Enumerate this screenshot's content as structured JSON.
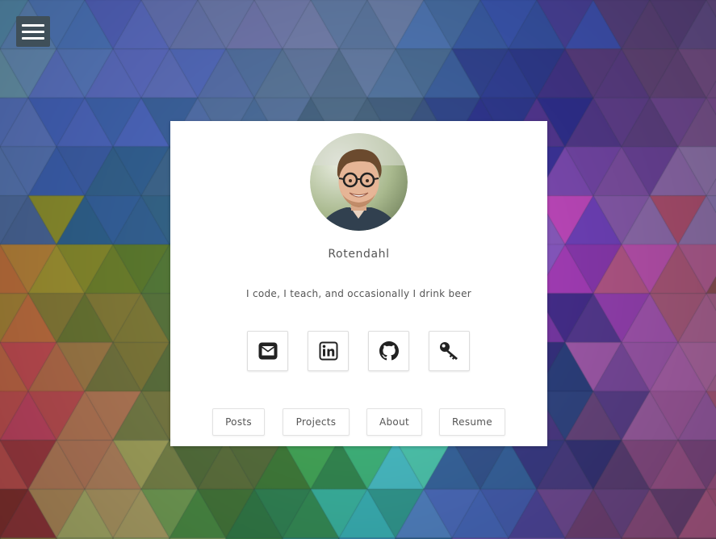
{
  "menu": {
    "icon": "hamburger-icon"
  },
  "profile": {
    "name": "Rotendahl",
    "tagline": "I code, I teach, and occasionally I drink beer"
  },
  "social_links": [
    {
      "icon": "envelope-icon"
    },
    {
      "icon": "linkedin-icon"
    },
    {
      "icon": "github-icon"
    },
    {
      "icon": "key-icon"
    }
  ],
  "nav": {
    "posts_label": "Posts",
    "projects_label": "Projects",
    "about_label": "About",
    "resume_label": "Resume"
  },
  "colors": {
    "card_background": "#ffffff",
    "text": "#555555",
    "menu_button": "#3f4f59",
    "icon": "#222222"
  }
}
